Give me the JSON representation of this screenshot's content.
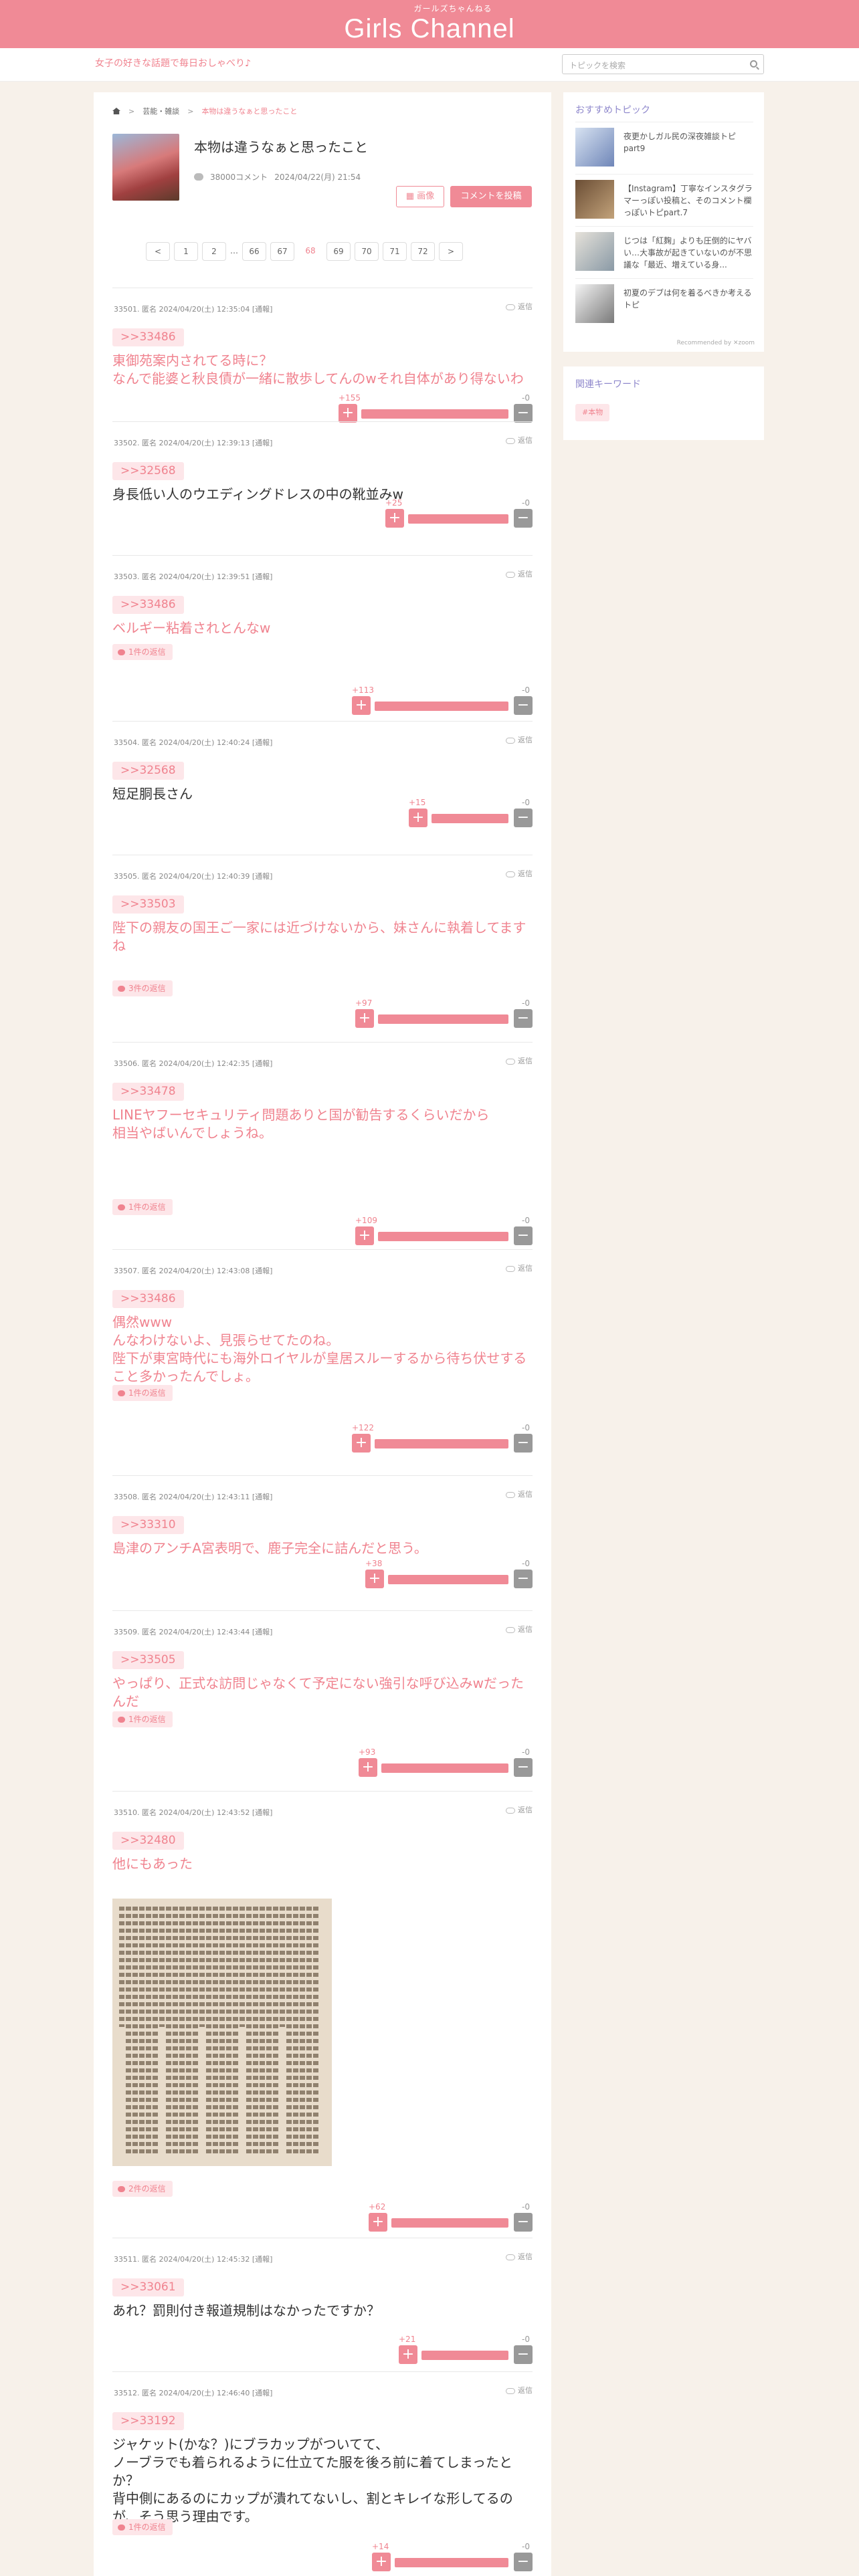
{
  "header": {
    "site_kana": "ガールズちゃんねる",
    "site_name": "Girls Channel",
    "tagline": "女子の好きな話題で毎日おしゃべり♪",
    "search_placeholder": "トピックを検索"
  },
  "breadcrumb": {
    "category": "芸能・雑談",
    "current": "本物は違うなぁと思ったこと"
  },
  "topic": {
    "title": "本物は違うなぁと思ったこと",
    "comment_count": "38000コメント",
    "date": "2024/04/22(月) 21:54",
    "image_button": "画像",
    "post_button": "コメントを投稿"
  },
  "pager": {
    "prev": "<",
    "next": ">",
    "pages": [
      "1",
      "2",
      "…",
      "66",
      "67",
      "68",
      "69",
      "70",
      "71",
      "72"
    ],
    "current": "68"
  },
  "reply_label": "返信",
  "comments": [
    {
      "info": "33501. 匿名 2024/04/20(土) 12:35:04 [通報]",
      "anchor": ">>33486",
      "text": "東御苑案内されてる時に？\nなんで能婆と秋良債が一緒に散歩してんのwそれ自体があり得ないわ",
      "pink": true,
      "replies": "",
      "plus": "+155",
      "minus": "-0",
      "ratio": 1
    },
    {
      "info": "33502. 匿名 2024/04/20(土) 12:39:13 [通報]",
      "anchor": ">>32568",
      "text": "身長低い人のウエディングドレスの中の靴並みw",
      "pink": false,
      "replies": "",
      "plus": "+25",
      "minus": "-0",
      "ratio": 1
    },
    {
      "info": "33503. 匿名 2024/04/20(土) 12:39:51 [通報]",
      "anchor": ">>33486",
      "text": "ベルギー粘着されとんなw",
      "pink": true,
      "replies": "1件の返信",
      "plus": "+113",
      "minus": "-0",
      "ratio": 1
    },
    {
      "info": "33504. 匿名 2024/04/20(土) 12:40:24 [通報]",
      "anchor": ">>32568",
      "text": "短足胴長さん",
      "pink": false,
      "replies": "",
      "plus": "+15",
      "minus": "-0",
      "ratio": 1
    },
    {
      "info": "33505. 匿名 2024/04/20(土) 12:40:39 [通報]",
      "anchor": ">>33503",
      "text": "陛下の親友の国王ご一家には近づけないから、妹さんに執着してますね",
      "pink": true,
      "replies": "3件の返信",
      "plus": "+97",
      "minus": "-0",
      "ratio": 1
    },
    {
      "info": "33506. 匿名 2024/04/20(土) 12:42:35 [通報]",
      "anchor": ">>33478",
      "text": "LINEヤフーセキュリティ問題ありと国が勧告するくらいだから\n相当やばいんでしょうね。",
      "pink": true,
      "replies": "1件の返信",
      "plus": "+109",
      "minus": "-0",
      "ratio": 1
    },
    {
      "info": "33507. 匿名 2024/04/20(土) 12:43:08 [通報]",
      "anchor": ">>33486",
      "text": "偶然www\nんなわけないよ、見張らせてたのね。\n陛下が東宮時代にも海外ロイヤルが皇居スルーするから待ち伏せすること多かったんでしょ。",
      "pink": true,
      "replies": "1件の返信",
      "plus": "+122",
      "minus": "-0",
      "ratio": 1
    },
    {
      "info": "33508. 匿名 2024/04/20(土) 12:43:11 [通報]",
      "anchor": ">>33310",
      "text": "島津のアンチA宮表明で、鹿子完全に詰んだと思う。",
      "pink": true,
      "replies": "",
      "plus": "+38",
      "minus": "-0",
      "ratio": 1
    },
    {
      "info": "33509. 匿名 2024/04/20(土) 12:43:44 [通報]",
      "anchor": ">>33505",
      "text": "やっぱり、正式な訪問じゃなくて予定にない強引な呼び込みwだったんだ",
      "pink": true,
      "replies": "1件の返信",
      "plus": "+93",
      "minus": "-0",
      "ratio": 1
    },
    {
      "info": "33510. 匿名 2024/04/20(土) 12:43:52 [通報]",
      "anchor": ">>32480",
      "text": "他にもあった",
      "pink": true,
      "replies": "2件の返信",
      "plus": "+62",
      "minus": "-0",
      "ratio": 1
    },
    {
      "info": "33511. 匿名 2024/04/20(土) 12:45:32 [通報]",
      "anchor": ">>33061",
      "text": "あれ？罰則付き報道規制はなかったですか？",
      "pink": false,
      "replies": "",
      "plus": "+21",
      "minus": "-0",
      "ratio": 1
    },
    {
      "info": "33512. 匿名 2024/04/20(土) 12:46:40 [通報]",
      "anchor": ">>33192",
      "text": "ジャケット(かな？)にブラカップがついてて、\nノーブラでも着られるように仕立てた服を後ろ前に着てしまったとか？\n背中側にあるのにカップが潰れてないし、割とキレイな形してるのが、そう思う理由です。",
      "pink": false,
      "replies": "1件の返信",
      "plus": "+14",
      "minus": "-0",
      "ratio": 1
    }
  ],
  "sidebar": {
    "heading": "おすすめトピック",
    "items": [
      {
        "text": "夜更かしガル民の深夜雑談トピpart9"
      },
      {
        "text": "【Instagram】丁寧なインスタグラマーっぽい投稿と、そのコメント欄っぽいトピpart.7"
      },
      {
        "text": "じつは「紅麹」よりも圧倒的にヤバい…大事故が起きていないのが不思議な「最近、増えている身..."
      },
      {
        "text": "初夏のデブは何を着るべきか考えるトピ"
      }
    ],
    "recommended_by": "Recommended by ✕zoom",
    "keyword_heading": "関連キーワード",
    "keywords": [
      "#本物"
    ]
  }
}
